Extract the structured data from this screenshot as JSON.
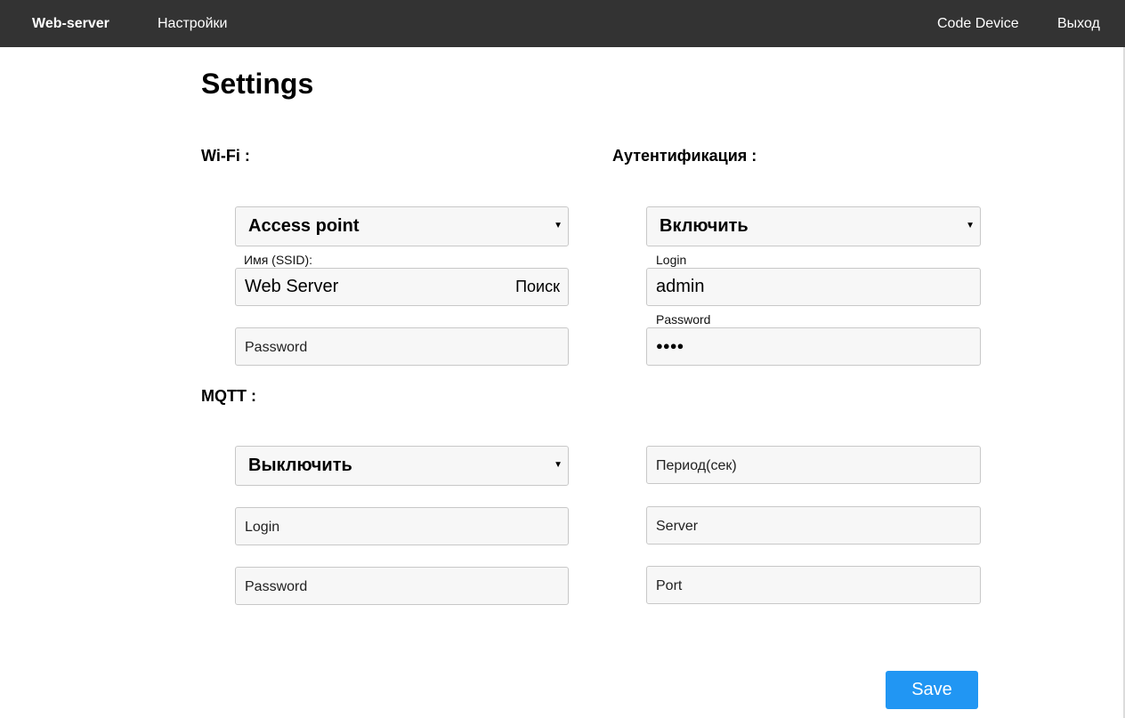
{
  "nav": {
    "brand": "Web-server",
    "settings": "Настройки",
    "code_device": "Code Device",
    "exit": "Выход"
  },
  "page": {
    "title": "Settings"
  },
  "wifi": {
    "title": "Wi-Fi :",
    "mode_selected": "Access point",
    "ssid_label": "Имя (SSID):",
    "ssid_value": "Web Server",
    "search_label": "Поиск",
    "password_placeholder": "Password"
  },
  "auth": {
    "title": "Аутентификация :",
    "mode_selected": "Включить",
    "login_label": "Login",
    "login_value": "admin",
    "password_label": "Password",
    "password_masked": "●●●●"
  },
  "mqtt": {
    "title": "MQTT :",
    "mode_selected": "Выключить",
    "login_placeholder": "Login",
    "password_placeholder": "Password",
    "period_placeholder": "Период(сек)",
    "server_placeholder": "Server",
    "port_placeholder": "Port"
  },
  "actions": {
    "save_label": "Save"
  },
  "colors": {
    "topbar": "#333333",
    "primary_button": "#2196f3",
    "field_background": "#f7f7f7",
    "field_border": "#c8c8c8"
  },
  "icons": {
    "select_caret": "dropdown-caret-icon"
  }
}
